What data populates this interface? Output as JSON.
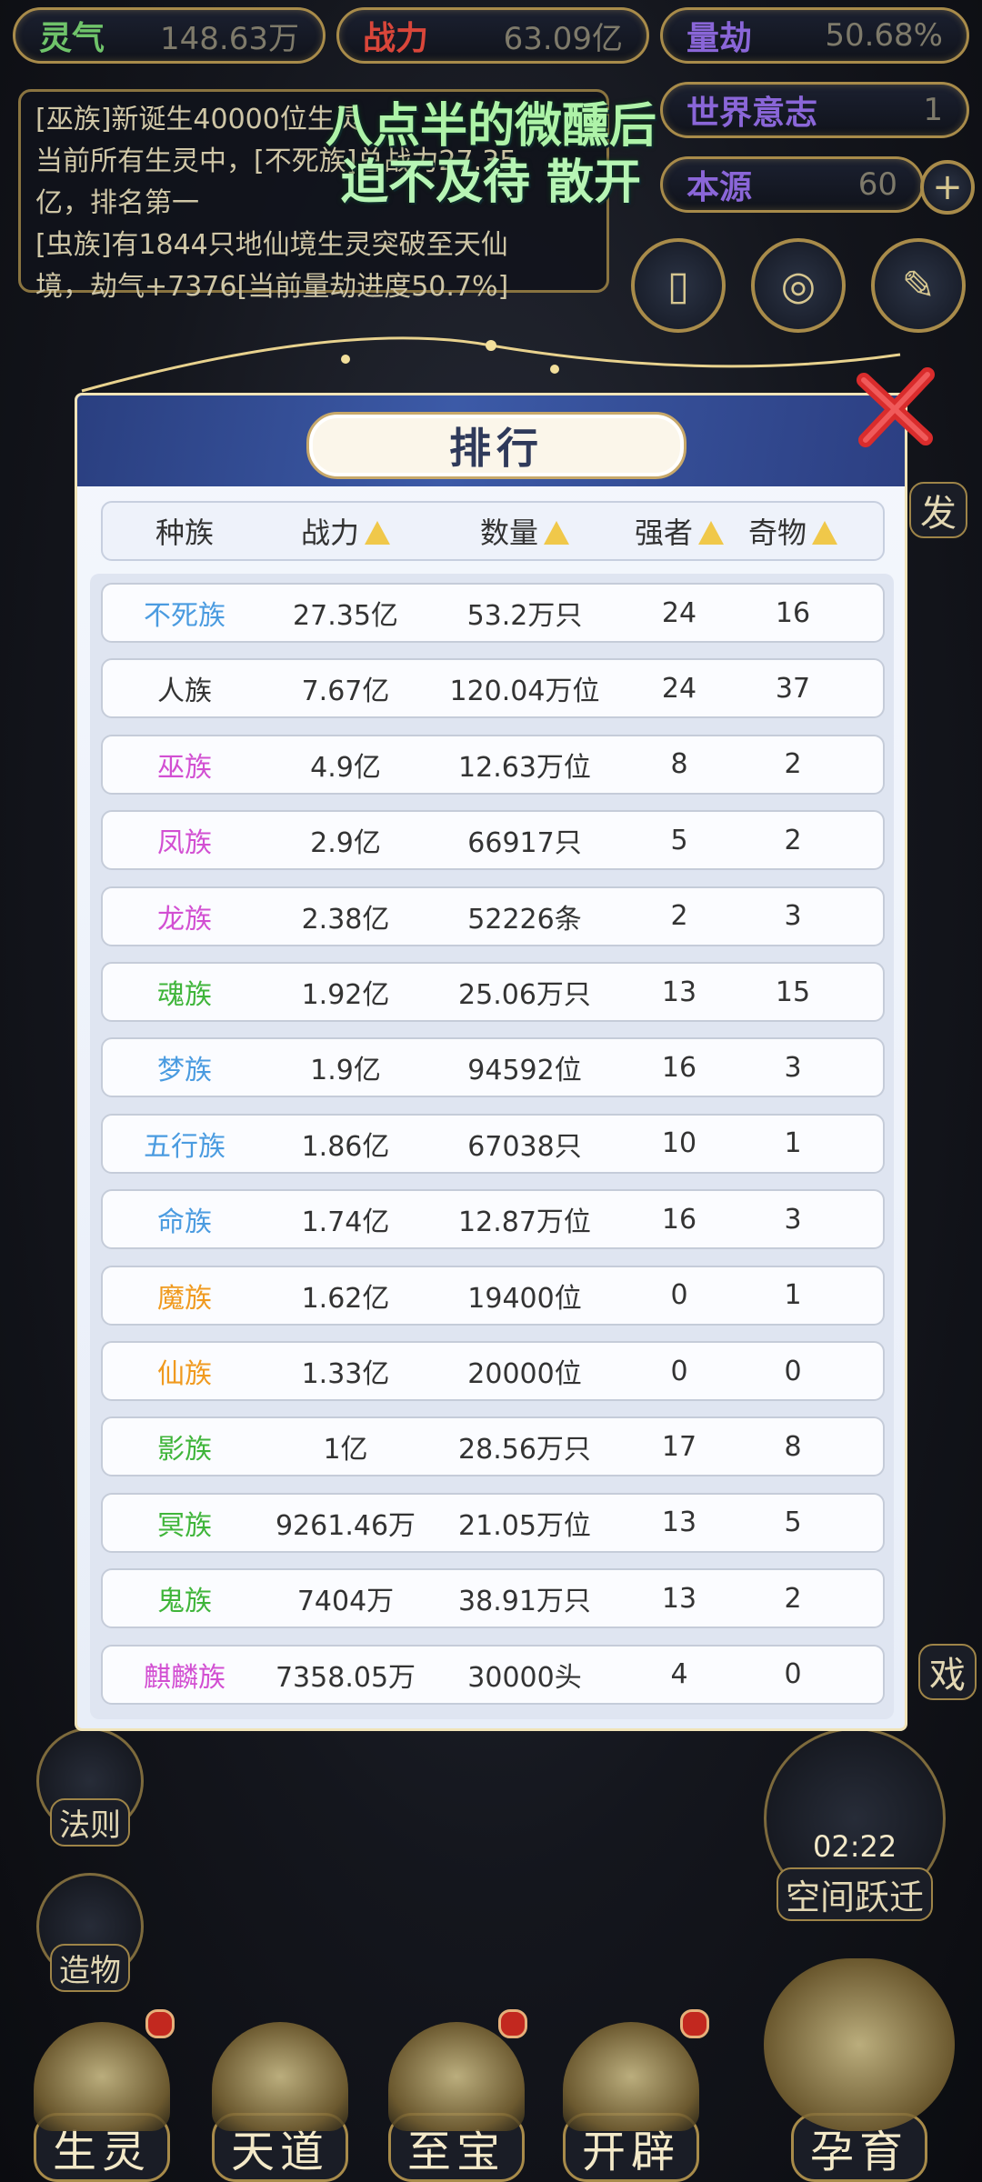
{
  "stats": {
    "lingqi": {
      "label": "灵气",
      "value": "148.63万"
    },
    "zhanli": {
      "label": "战力",
      "value": "63.09亿"
    },
    "liangjie": {
      "label": "量劫",
      "value": "50.68%"
    },
    "shijie": {
      "label": "世界意志",
      "value": "1"
    },
    "benyuan": {
      "label": "本源",
      "value": "60"
    }
  },
  "log": {
    "line1": "[巫族]新诞生40000位生灵",
    "line2": "当前所有生灵中，[不死族]总战力27.35",
    "line3": "亿，排名第一",
    "line4": "[虫族]有1844只地仙境生灵突破至天仙",
    "line5": "境，劫气+7376[当前量劫进度50.7%]"
  },
  "overlay": {
    "line1": "八点半的微醺后",
    "line2": "迫不及待 散开"
  },
  "side": {
    "fazhe": "法则",
    "zaowu": "造物",
    "right_top": "发",
    "right_mid": "戏"
  },
  "timer": {
    "time": "02:22",
    "label": "空间跃迁"
  },
  "nav": {
    "shengling": "生灵",
    "tiandao": "天道",
    "zhibao": "至宝",
    "kaipi": "开辟",
    "yunyu": "孕育"
  },
  "modal": {
    "title": "排行",
    "headers": {
      "race": "种族",
      "power": "战力",
      "count": "数量",
      "strong": "强者",
      "treasure": "奇物"
    },
    "rows": [
      {
        "race": "不死族",
        "power": "27.35亿",
        "count": "53.2万只",
        "strong": "24",
        "treasure": "16",
        "color": "#4a9be0"
      },
      {
        "race": "人族",
        "power": "7.67亿",
        "count": "120.04万位",
        "strong": "24",
        "treasure": "37",
        "color": "#333333"
      },
      {
        "race": "巫族",
        "power": "4.9亿",
        "count": "12.63万位",
        "strong": "8",
        "treasure": "2",
        "color": "#d24fd2"
      },
      {
        "race": "凤族",
        "power": "2.9亿",
        "count": "66917只",
        "strong": "5",
        "treasure": "2",
        "color": "#d24fd2"
      },
      {
        "race": "龙族",
        "power": "2.38亿",
        "count": "52226条",
        "strong": "2",
        "treasure": "3",
        "color": "#d24fd2"
      },
      {
        "race": "魂族",
        "power": "1.92亿",
        "count": "25.06万只",
        "strong": "13",
        "treasure": "15",
        "color": "#3fb53a"
      },
      {
        "race": "梦族",
        "power": "1.9亿",
        "count": "94592位",
        "strong": "16",
        "treasure": "3",
        "color": "#4a9be0"
      },
      {
        "race": "五行族",
        "power": "1.86亿",
        "count": "67038只",
        "strong": "10",
        "treasure": "1",
        "color": "#4a9be0"
      },
      {
        "race": "命族",
        "power": "1.74亿",
        "count": "12.87万位",
        "strong": "16",
        "treasure": "3",
        "color": "#4a9be0"
      },
      {
        "race": "魔族",
        "power": "1.62亿",
        "count": "19400位",
        "strong": "0",
        "treasure": "1",
        "color": "#f09a1f"
      },
      {
        "race": "仙族",
        "power": "1.33亿",
        "count": "20000位",
        "strong": "0",
        "treasure": "0",
        "color": "#f09a1f"
      },
      {
        "race": "影族",
        "power": "1亿",
        "count": "28.56万只",
        "strong": "17",
        "treasure": "8",
        "color": "#3fb53a"
      },
      {
        "race": "冥族",
        "power": "9261.46万",
        "count": "21.05万位",
        "strong": "13",
        "treasure": "5",
        "color": "#3fb53a"
      },
      {
        "race": "鬼族",
        "power": "7404万",
        "count": "38.91万只",
        "strong": "13",
        "treasure": "2",
        "color": "#3fb53a"
      },
      {
        "race": "麒麟族",
        "power": "7358.05万",
        "count": "30000头",
        "strong": "4",
        "treasure": "0",
        "color": "#d24fd2"
      }
    ]
  }
}
